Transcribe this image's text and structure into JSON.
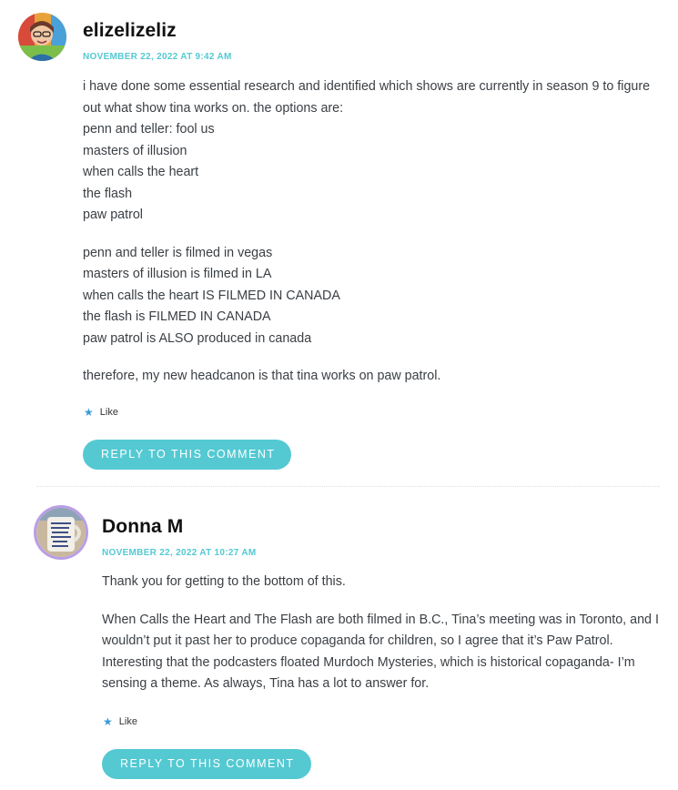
{
  "comments": [
    {
      "author": "elizelizeliz",
      "date": "NOVEMBER 22, 2022 AT 9:42 AM",
      "paragraphs": [
        [
          "i have done some essential research and identified which shows are currently in season 9 to figure out what show tina works on. the options are:",
          "penn and teller: fool us",
          "masters of illusion",
          "when calls the heart",
          "the flash",
          "paw patrol"
        ],
        [
          "penn and teller is filmed in vegas",
          "masters of illusion is filmed in LA",
          "when calls the heart IS FILMED IN CANADA",
          "the flash is FILMED IN CANADA",
          "paw patrol is ALSO produced in canada"
        ],
        [
          "therefore, my new headcanon is that tina works on paw patrol."
        ]
      ],
      "like_label": "Like",
      "reply_label": "REPLY TO THIS COMMENT",
      "avatar_icon": "user-avatar-photo"
    },
    {
      "author": "Donna M",
      "date": "NOVEMBER 22, 2022 AT 10:27 AM",
      "paragraphs": [
        [
          "Thank you for getting to the bottom of this."
        ],
        [
          "When Calls the Heart and The Flash are both filmed in B.C., Tina’s meeting was in Toronto, and I wouldn’t put it past her to produce copaganda for children, so I agree that it’s Paw Patrol. Interesting that the podcasters floated Murdoch Mysteries, which is historical copaganda- I’m sensing a theme. As always, Tina has a lot to answer for."
        ]
      ],
      "like_label": "Like",
      "reply_label": "REPLY TO THIS COMMENT",
      "avatar_icon": "mug-avatar-photo"
    }
  ],
  "colors": {
    "accent": "#54c9d2",
    "like_star": "#3b9ad6",
    "text": "#3a3f44",
    "author": "#111111",
    "avatar_ring": "#b99ee6"
  },
  "icons": {
    "like": "star-icon"
  }
}
